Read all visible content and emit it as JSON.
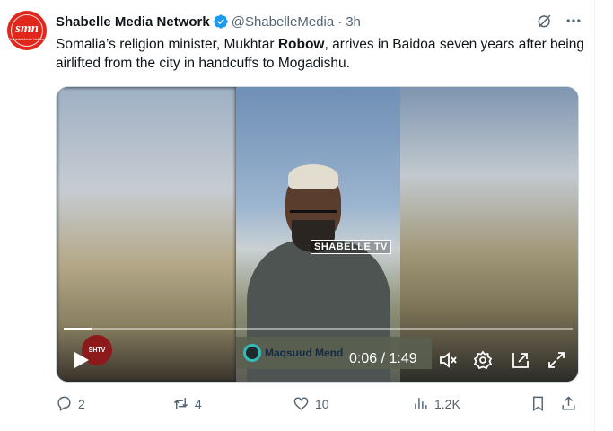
{
  "tweet": {
    "author_name": "Shabelle Media Network",
    "handle": "@ShabelleMedia",
    "separator": "·",
    "time": "3h",
    "avatar_text": "smn",
    "avatar_subtext": "Shabelle Media Network",
    "text_before": "Somalia’s religion minister, Mukhtar ",
    "text_bold": "Robow",
    "text_after": ", arrives in Baidoa seven years after being airlifted from the city in handcuffs to Mogadishu."
  },
  "video": {
    "watermark": "SHABELLE TV",
    "lower_third_name": "Maqsuud Mend",
    "channel_logo": "SHTV",
    "current_time": "0:06",
    "time_separator": "/",
    "duration": "1:49",
    "progress_fraction": 0.055,
    "icons": [
      "play-icon",
      "mute-icon",
      "settings-icon",
      "pip-icon",
      "fullscreen-icon"
    ]
  },
  "actions": {
    "replies": "2",
    "reposts": "4",
    "likes": "10",
    "views": "1.2K"
  },
  "colors": {
    "text": "#0f1419",
    "secondary": "#536471",
    "verified": "#1d9bf0",
    "avatar_bg": "#e1261c"
  }
}
